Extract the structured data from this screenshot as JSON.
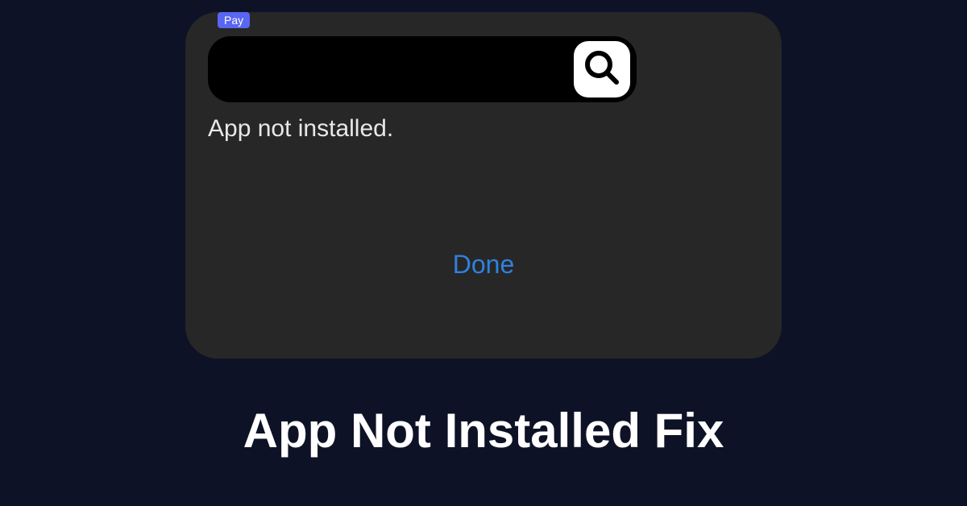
{
  "dialog": {
    "badge_label": "Pay",
    "message": "App not installed.",
    "done_label": "Done"
  },
  "caption": "App Not Installed Fix",
  "colors": {
    "background": "#0e1226",
    "dialog_bg": "#272727",
    "accent_blue": "#2f82df",
    "badge_bg": "#5966f3"
  }
}
